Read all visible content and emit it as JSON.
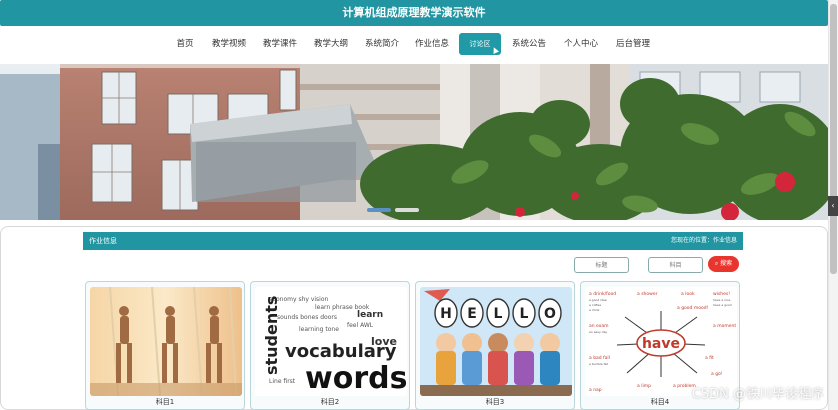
{
  "header": {
    "title": "计算机组成原理教学演示软件"
  },
  "nav": {
    "items": [
      {
        "label": "首页"
      },
      {
        "label": "教学视频"
      },
      {
        "label": "教学课件"
      },
      {
        "label": "教学大纲"
      },
      {
        "label": "系统简介"
      },
      {
        "label": "作业信息"
      },
      {
        "label": "讨论区",
        "active": true
      },
      {
        "label": "系统公告"
      },
      {
        "label": "个人中心"
      },
      {
        "label": "后台管理"
      }
    ]
  },
  "banner": {
    "scene": "campus building photo with camellia flowers",
    "slides": 2,
    "active_slide": 1
  },
  "section": {
    "title": "作业信息",
    "breadcrumb": "您现在的位置：作业信息"
  },
  "search": {
    "title_placeholder": "标题",
    "subject_placeholder": "科目",
    "button_label": "搜索",
    "button_color": "#e8362e"
  },
  "cards": [
    {
      "label": "科目1",
      "image": "yoga-class-photo"
    },
    {
      "label": "科目2",
      "image": "vocabulary-words-cloud"
    },
    {
      "label": "科目3",
      "image": "hello-kids-cartoon"
    },
    {
      "label": "科目4",
      "image": "have-mindmap"
    }
  ],
  "wordcloud": {
    "big": "words",
    "mid": "vocabulary",
    "side": "students"
  },
  "hello": {
    "letters": [
      "H",
      "E",
      "L",
      "L",
      "O"
    ]
  },
  "mindmap": {
    "center": "have",
    "branches": [
      "a drink/food",
      "a shower",
      "a look",
      "wishes!",
      "an exam",
      "a good mood!",
      "a moment",
      "a bad fall",
      "a limp",
      "a problem",
      "a fit",
      "a go!",
      "a nap"
    ]
  },
  "watermark": "CSDN @铁川毕设程序",
  "colors": {
    "teal": "#2196a2",
    "accent_red": "#e8362e"
  }
}
